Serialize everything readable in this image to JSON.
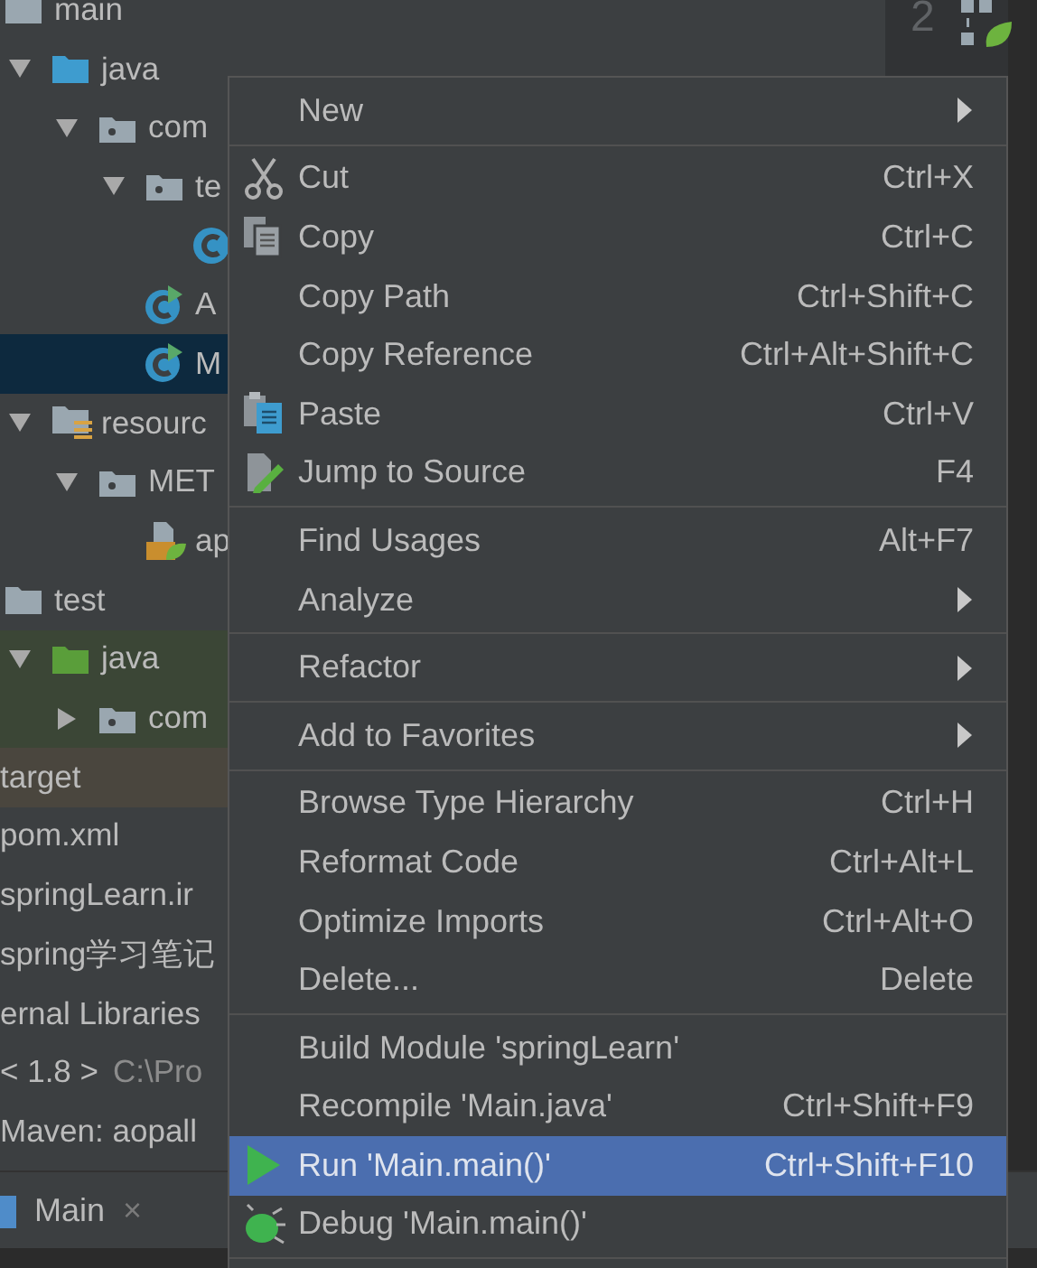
{
  "project_tree": {
    "items": [
      {
        "label": "main",
        "kind": "folder",
        "selected": false,
        "children": [
          {
            "label": "java",
            "kind": "source-folder",
            "expanded": true,
            "selected": false,
            "children": [
              {
                "label": "com",
                "kind": "package",
                "expanded": true,
                "selected": false,
                "children": [
                  {
                    "label": "te",
                    "kind": "package",
                    "expanded": true,
                    "selected": false,
                    "children": [
                      {
                        "kind": "class",
                        "selected": false
                      }
                    ]
                  },
                  {
                    "label": "A",
                    "kind": "runnable-class",
                    "selected": false
                  },
                  {
                    "label": "M",
                    "kind": "runnable-class",
                    "selected": true
                  }
                ]
              }
            ]
          },
          {
            "label": "resourc",
            "kind": "resources-folder",
            "expanded": true,
            "selected": false,
            "children": [
              {
                "label": "MET",
                "kind": "package",
                "expanded": true,
                "selected": false,
                "children": [
                  {
                    "label": "ap",
                    "kind": "spring-xml",
                    "selected": false
                  }
                ]
              }
            ]
          }
        ]
      },
      {
        "label": "test",
        "kind": "folder",
        "selected": false,
        "children": [
          {
            "label": "java",
            "kind": "test-folder",
            "expanded": true,
            "selected": false,
            "children": [
              {
                "label": "com",
                "kind": "package",
                "expanded": false,
                "selected": false
              }
            ]
          }
        ]
      },
      {
        "label": "target",
        "kind": "excluded-folder",
        "selected": false
      },
      {
        "label": "pom.xml",
        "selected": false
      },
      {
        "label": "springLearn.ir",
        "selected": false
      },
      {
        "label": "spring学习笔记",
        "selected": false
      },
      {
        "label": "ernal Libraries",
        "selected": false
      },
      {
        "label": "< 1.8 >",
        "path": "C:\\Pro",
        "selected": false
      },
      {
        "label": "Maven: aopall",
        "selected": false
      }
    ]
  },
  "editor": {
    "gutter_line": "2",
    "tabs": [
      {
        "label": "Main",
        "close": "×"
      }
    ]
  },
  "context_menu": {
    "groups": [
      [
        {
          "label": "New",
          "submenu": true,
          "selected": false
        }
      ],
      [
        {
          "label": "Cut",
          "shortcut": "Ctrl+X",
          "kind": "scissors",
          "selected": false
        },
        {
          "label": "Copy",
          "shortcut": "Ctrl+C",
          "kind": "copy",
          "selected": false
        },
        {
          "label": "Copy Path",
          "shortcut": "Ctrl+Shift+C",
          "selected": false
        },
        {
          "label": "Copy Reference",
          "shortcut": "Ctrl+Alt+Shift+C",
          "selected": false
        },
        {
          "label": "Paste",
          "shortcut": "Ctrl+V",
          "kind": "paste",
          "selected": false
        },
        {
          "label": "Jump to Source",
          "shortcut": "F4",
          "kind": "edit-source",
          "selected": false
        }
      ],
      [
        {
          "label": "Find Usages",
          "shortcut": "Alt+F7",
          "selected": false
        },
        {
          "label": "Analyze",
          "submenu": true,
          "selected": false
        }
      ],
      [
        {
          "label": "Refactor",
          "submenu": true,
          "selected": false
        }
      ],
      [
        {
          "label": "Add to Favorites",
          "submenu": true,
          "selected": false
        }
      ],
      [
        {
          "label": "Browse Type Hierarchy",
          "shortcut": "Ctrl+H",
          "selected": false
        },
        {
          "label": "Reformat Code",
          "shortcut": "Ctrl+Alt+L",
          "selected": false
        },
        {
          "label": "Optimize Imports",
          "shortcut": "Ctrl+Alt+O",
          "selected": false
        },
        {
          "label": "Delete...",
          "shortcut": "Delete",
          "selected": false
        }
      ],
      [
        {
          "label": "Build Module 'springLearn'",
          "selected": false
        },
        {
          "label": "Recompile 'Main.java'",
          "shortcut": "Ctrl+Shift+F9",
          "selected": false
        },
        {
          "label": "Run 'Main.main()'",
          "shortcut": "Ctrl+Shift+F10",
          "kind": "run",
          "selected": true
        },
        {
          "label": "Debug 'Main.main()'",
          "kind": "debug",
          "selected": false
        }
      ]
    ]
  }
}
